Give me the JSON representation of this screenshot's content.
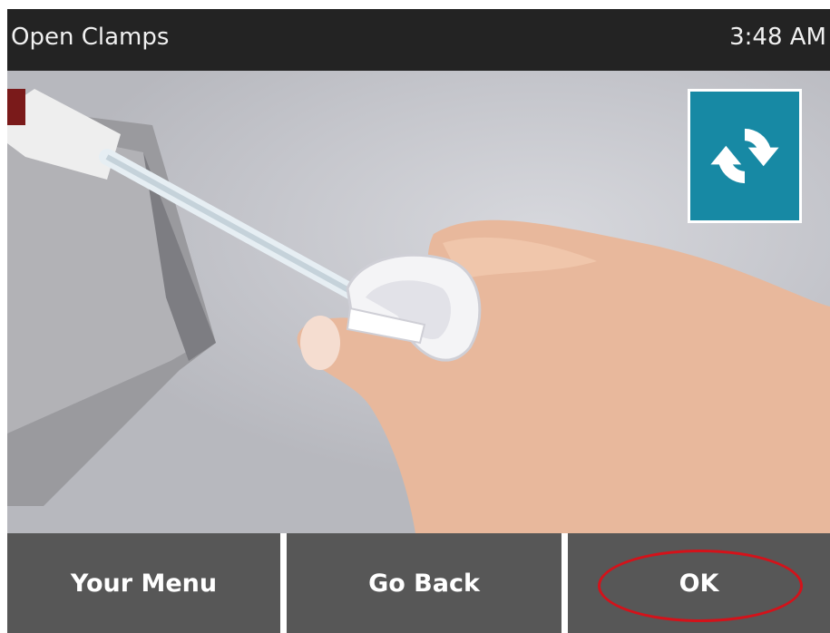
{
  "header": {
    "title": "Open Clamps",
    "time": "3:48 AM"
  },
  "scene": {
    "image": "hand-opening-tube-clamp",
    "refresh_icon": "refresh-icon"
  },
  "footer": {
    "menu_label": "Your Menu",
    "back_label": "Go Back",
    "ok_label": "OK"
  },
  "colors": {
    "header_bg": "#232323",
    "button_bg": "#575757",
    "refresh_bg": "#1789a4",
    "highlight": "#d4121a"
  }
}
